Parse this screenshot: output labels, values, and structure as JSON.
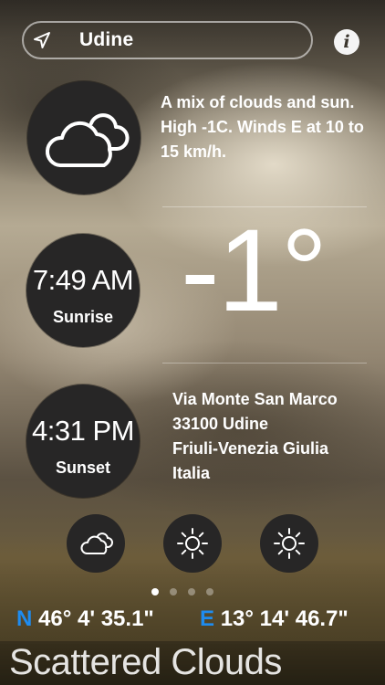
{
  "location": {
    "name": "Udine",
    "icon": "location-arrow-icon"
  },
  "info": {
    "label": "i",
    "icon": "info-icon"
  },
  "current": {
    "icon": "cloudy-icon",
    "description": "A mix of clouds and sun. High -1C. Winds E at 10 to 15 km/h.",
    "temperature": "-1°"
  },
  "sunrise": {
    "time": "7:49 AM",
    "label": "Sunrise"
  },
  "sunset": {
    "time": "4:31 PM",
    "label": "Sunset"
  },
  "address": {
    "line1": "Via Monte San Marco",
    "line2": "33100 Udine",
    "line3": "Friuli-Venezia Giulia",
    "line4": "Italia"
  },
  "forecast": [
    {
      "icon": "cloudy-icon"
    },
    {
      "icon": "sun-icon"
    },
    {
      "icon": "sun-icon"
    }
  ],
  "pager": {
    "total": 4,
    "active": 0
  },
  "coordinates": {
    "lat_dir": "N",
    "lat": "46° 4' 35.1\"",
    "lon_dir": "E",
    "lon": "13° 14' 46.7\""
  },
  "condition": "Scattered Clouds",
  "colors": {
    "accent": "#1e8cf0",
    "circle": "#272626"
  }
}
